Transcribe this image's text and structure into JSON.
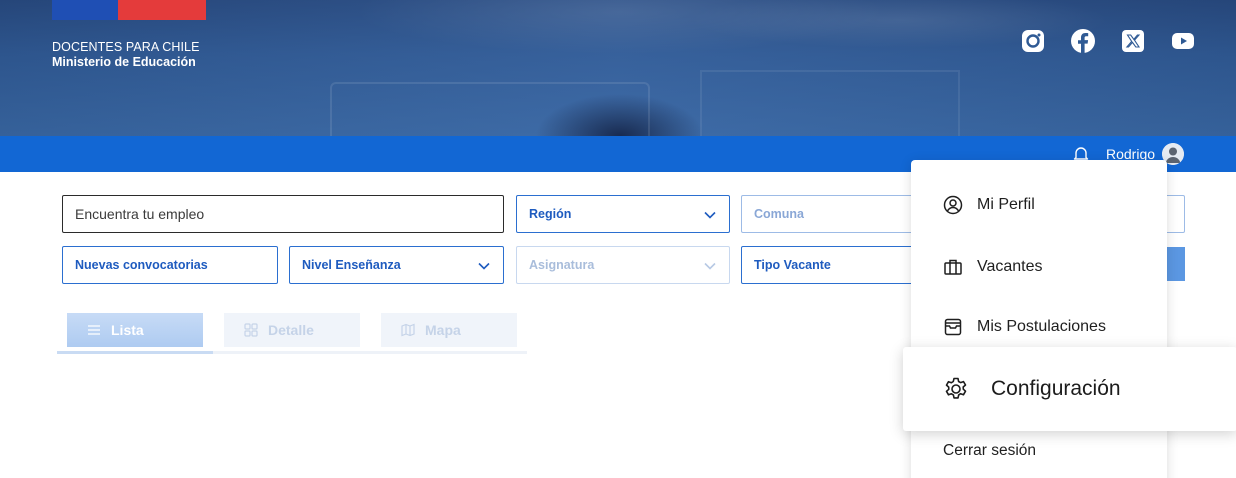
{
  "header": {
    "brand_line1": "DOCENTES PARA CHILE",
    "brand_line2": "Ministerio de Educación",
    "social_icons": [
      "instagram-icon",
      "facebook-icon",
      "x-icon",
      "youtube-icon"
    ]
  },
  "userbar": {
    "username": "Rodrigo",
    "bell_icon": "bell-icon",
    "avatar_icon": "user-avatar-icon"
  },
  "filters": {
    "search_placeholder": "Encuentra tu empleo",
    "region": "Región",
    "comuna": "Comuna",
    "nuevas": "Nuevas convocatorias",
    "nivel": "Nivel Enseñanza",
    "asignatura": "Asignatura",
    "tipo": "Tipo Vacante"
  },
  "tabs": [
    {
      "label": "Lista",
      "icon": "list-icon",
      "active": true
    },
    {
      "label": "Detalle",
      "icon": "grid-icon",
      "active": false
    },
    {
      "label": "Mapa",
      "icon": "map-icon",
      "active": false
    }
  ],
  "menu": {
    "items": [
      {
        "label": "Mi Perfil",
        "icon": "user-circle-icon"
      },
      {
        "label": "Vacantes",
        "icon": "briefcase-icon"
      },
      {
        "label": "Mis Postulaciones",
        "icon": "inbox-icon"
      },
      {
        "label": "Configuración",
        "icon": "gear-icon"
      },
      {
        "label": "Cerrar sesión",
        "icon": ""
      }
    ]
  },
  "colors": {
    "primary_blue": "#1267d4",
    "flag_blue": "#1f4fb4",
    "flag_red": "#e43b3b",
    "select_text": "#1e5bbf"
  }
}
